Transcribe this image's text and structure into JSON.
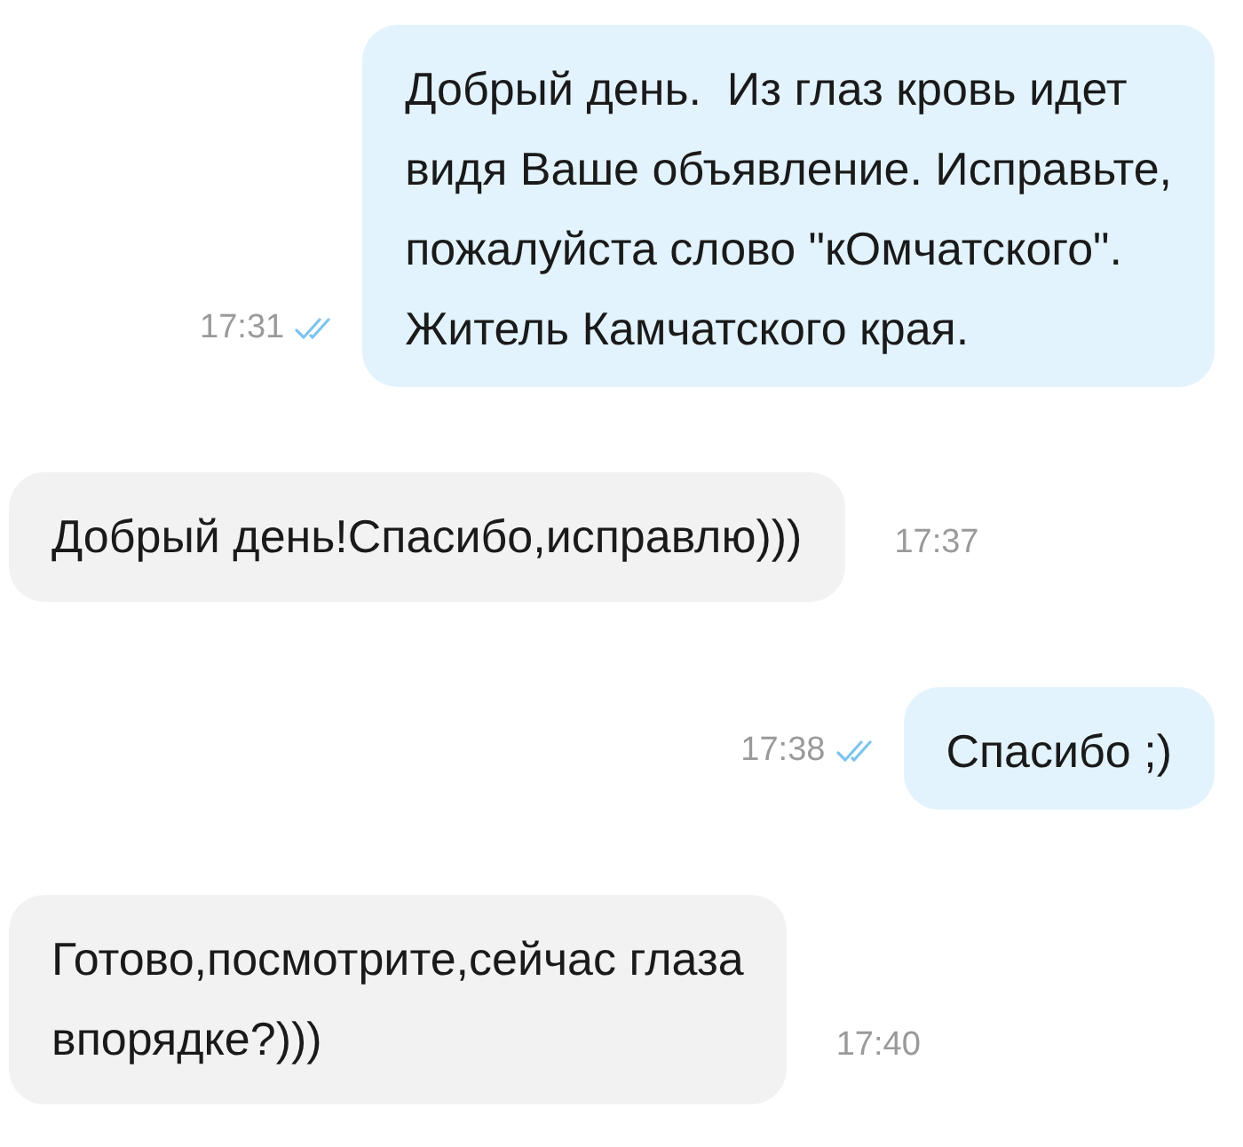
{
  "messages": [
    {
      "kind": "outgoing",
      "text": "Добрый день.  Из глаз кровь идет\nвидя Ваше объявление. Исправьте,\nпожалуйста слово \"кОмчатского\".\nЖитель Камчатского края.",
      "time": "17:31",
      "read": true
    },
    {
      "kind": "incoming",
      "text": "Добрый день!Спасибо,исправлю)))",
      "time": "17:37"
    },
    {
      "kind": "outgoing",
      "text": "Спасибо ;)",
      "time": "17:38",
      "read": true
    },
    {
      "kind": "incoming",
      "text": "Готово,посмотрите,сейчас глаза\nвпорядке?)))",
      "time": "17:40"
    }
  ]
}
